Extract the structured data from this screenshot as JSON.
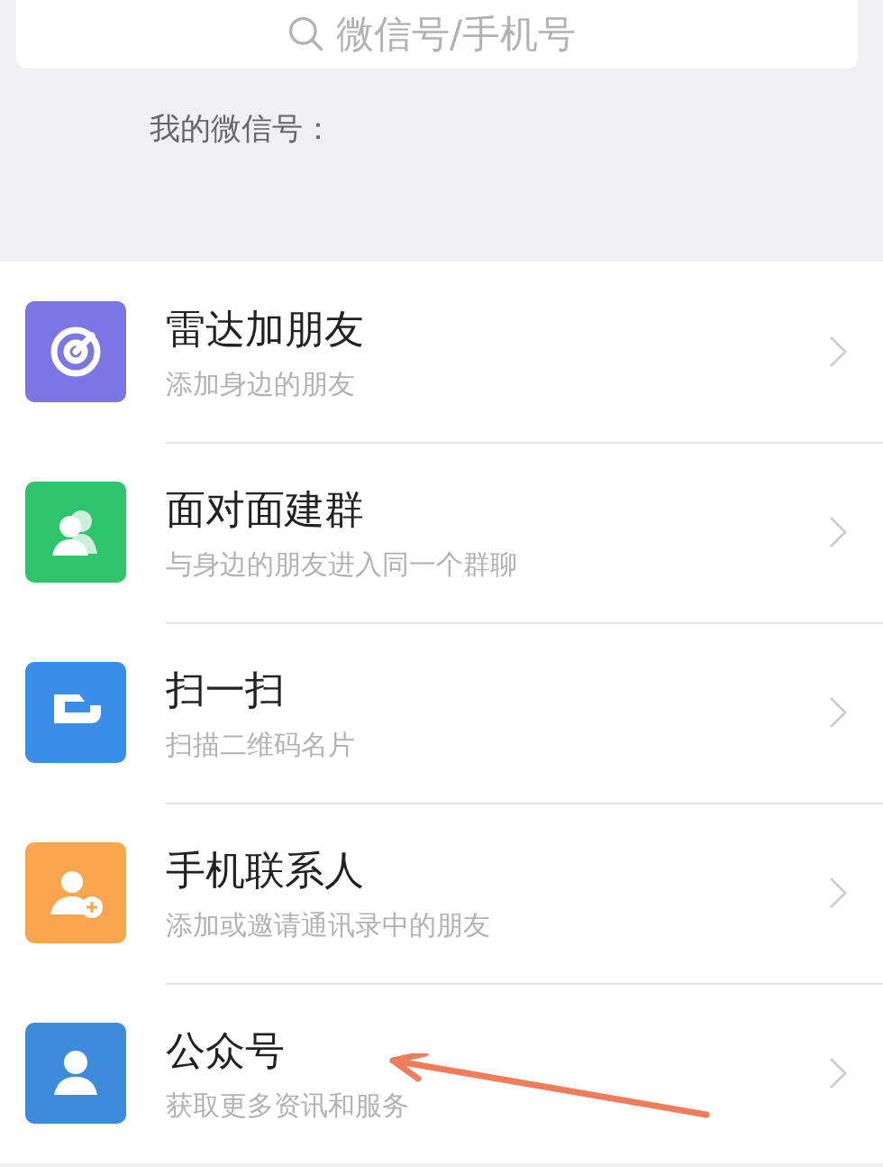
{
  "search": {
    "placeholder": "微信号/手机号"
  },
  "my_id": {
    "label": "我的微信号："
  },
  "items": [
    {
      "kind": "radar",
      "color": "#7b75e6",
      "title": "雷达加朋友",
      "subtitle": "添加身边的朋友"
    },
    {
      "kind": "group",
      "color": "#2dc46c",
      "title": "面对面建群",
      "subtitle": "与身边的朋友进入同一个群聊"
    },
    {
      "kind": "scan",
      "color": "#3b8ee8",
      "title": "扫一扫",
      "subtitle": "扫描二维码名片"
    },
    {
      "kind": "contact-add",
      "color": "#f9a54e",
      "title": "手机联系人",
      "subtitle": "添加或邀请通讯录中的朋友"
    },
    {
      "kind": "official",
      "color": "#3d8cdc",
      "title": "公众号",
      "subtitle": "获取更多资讯和服务"
    }
  ]
}
